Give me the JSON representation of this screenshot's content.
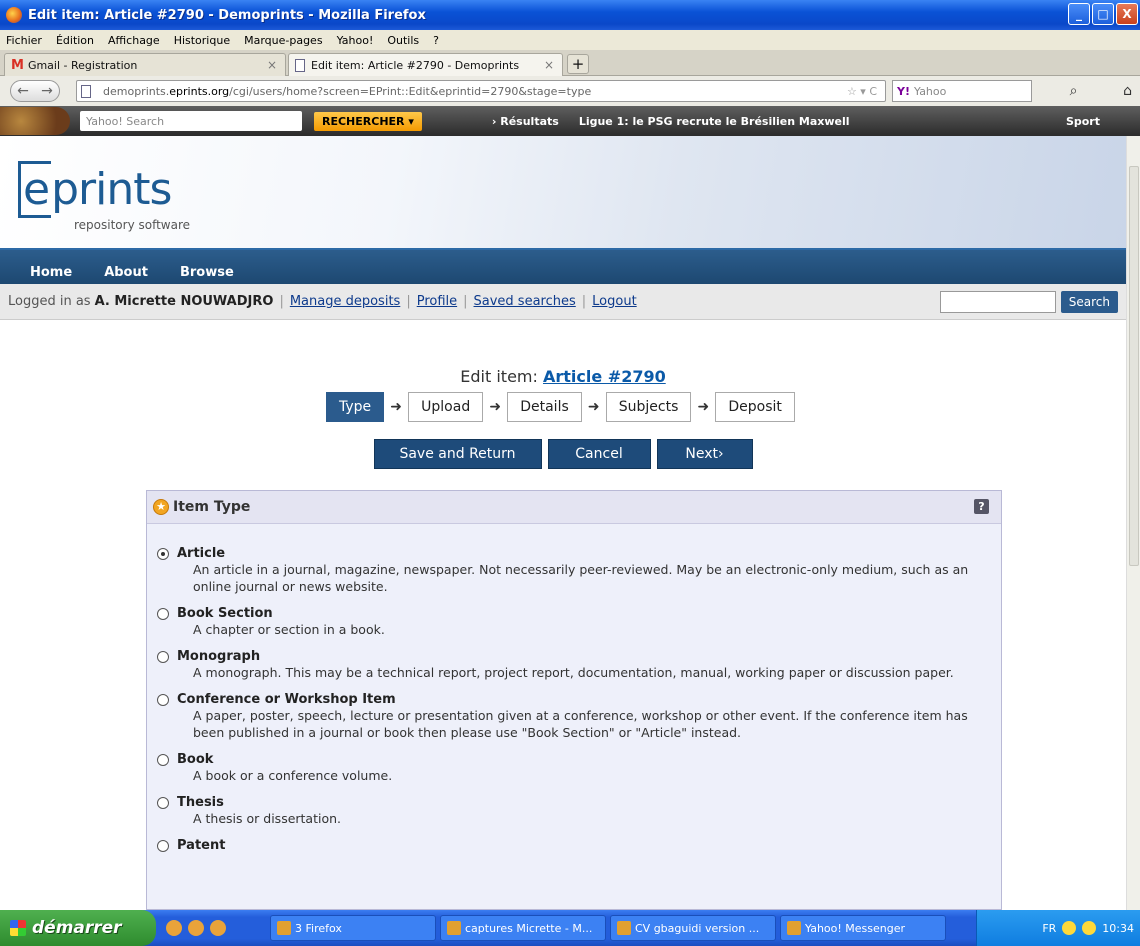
{
  "window": {
    "title": "Edit item: Article #2790 - Demoprints - Mozilla Firefox",
    "controls": [
      "_",
      "□",
      "X"
    ]
  },
  "menubar": [
    "Fichier",
    "Édition",
    "Affichage",
    "Historique",
    "Marque-pages",
    "Yahoo!",
    "Outils",
    "?"
  ],
  "tabs": [
    {
      "label": "Gmail - Registration",
      "active": false
    },
    {
      "label": "Edit item: Article #2790 - Demoprints",
      "active": true
    }
  ],
  "nav": {
    "url_prefix": "demoprints.",
    "url_domain": "eprints.org",
    "url_rest": "/cgi/users/home?screen=EPrint::Edit&eprintid=2790&stage=type",
    "search_placeholder": "Yahoo"
  },
  "yahoo_toolbar": {
    "search_placeholder": "Yahoo! Search",
    "search_button": "RECHERCHER",
    "results": "› Résultats",
    "headline": "Ligue 1: le PSG recrute le Brésilien Maxwell",
    "sport": "Sport"
  },
  "site": {
    "logo_text": "eprints",
    "logo_sub": "repository software",
    "menu": [
      "Home",
      "About",
      "Browse"
    ]
  },
  "login": {
    "prefix": "Logged in as",
    "user": "A. Micrette NOUWADJRO",
    "links": [
      "Manage deposits",
      "Profile",
      "Saved searches",
      "Logout"
    ],
    "search_button": "Search"
  },
  "edit": {
    "title_prefix": "Edit item:",
    "title_link": "Article #2790",
    "stages": [
      "Type",
      "Upload",
      "Details",
      "Subjects",
      "Deposit"
    ],
    "active_stage": "Type",
    "buttons": {
      "save": "Save and Return",
      "cancel": "Cancel",
      "next": "Next›"
    }
  },
  "panel": {
    "title": "Item Type",
    "help": "?",
    "options": [
      {
        "name": "Article",
        "checked": true,
        "desc": "An article in a journal, magazine, newspaper. Not necessarily peer-reviewed. May be an electronic-only medium, such as an online journal or news website."
      },
      {
        "name": "Book Section",
        "checked": false,
        "desc": "A chapter or section in a book."
      },
      {
        "name": "Monograph",
        "checked": false,
        "desc": "A monograph. This may be a technical report, project report, documentation, manual, working paper or discussion paper."
      },
      {
        "name": "Conference or Workshop Item",
        "checked": false,
        "desc": "A paper, poster, speech, lecture or presentation given at a conference, workshop or other event. If the conference item has been published in a journal or book then please use \"Book Section\" or \"Article\" instead."
      },
      {
        "name": "Book",
        "checked": false,
        "desc": "A book or a conference volume."
      },
      {
        "name": "Thesis",
        "checked": false,
        "desc": "A thesis or dissertation."
      },
      {
        "name": "Patent",
        "checked": false,
        "desc": ""
      }
    ]
  },
  "taskbar": {
    "start": "démarrer",
    "tasks": [
      "3 Firefox",
      "captures Micrette - M...",
      "CV gbaguidi version ...",
      "Yahoo! Messenger"
    ],
    "lang": "FR",
    "clock": "10:34"
  }
}
